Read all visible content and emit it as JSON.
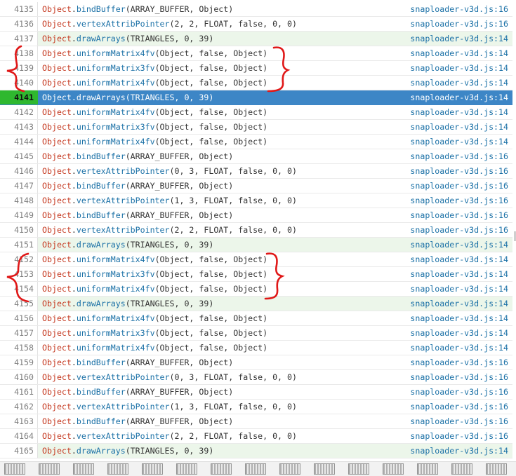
{
  "rows": [
    {
      "line": "4135",
      "obj": "Object",
      "fn": "bindBuffer",
      "args": "(ARRAY_BUFFER, Object)",
      "src": "snaploader-v3d.js:16",
      "kind": "normal"
    },
    {
      "line": "4136",
      "obj": "Object",
      "fn": "vertexAttribPointer",
      "args": "(2, 2, FLOAT, false, 0, 0)",
      "src": "snaploader-v3d.js:16",
      "kind": "normal"
    },
    {
      "line": "4137",
      "obj": "Object",
      "fn": "drawArrays",
      "args": "(TRIANGLES, 0, 39)",
      "src": "snaploader-v3d.js:14",
      "kind": "draw"
    },
    {
      "line": "4138",
      "obj": "Object",
      "fn": "uniformMatrix4fv",
      "args": "(Object, false, Object)",
      "src": "snaploader-v3d.js:14",
      "kind": "normal"
    },
    {
      "line": "4139",
      "obj": "Object",
      "fn": "uniformMatrix3fv",
      "args": "(Object, false, Object)",
      "src": "snaploader-v3d.js:14",
      "kind": "normal"
    },
    {
      "line": "4140",
      "obj": "Object",
      "fn": "uniformMatrix4fv",
      "args": "(Object, false, Object)",
      "src": "snaploader-v3d.js:14",
      "kind": "normal"
    },
    {
      "line": "4141",
      "obj": "Object",
      "fn": "drawArrays",
      "args": "(TRIANGLES, 0, 39)",
      "src": "snaploader-v3d.js:14",
      "kind": "selected"
    },
    {
      "line": "4142",
      "obj": "Object",
      "fn": "uniformMatrix4fv",
      "args": "(Object, false, Object)",
      "src": "snaploader-v3d.js:14",
      "kind": "normal"
    },
    {
      "line": "4143",
      "obj": "Object",
      "fn": "uniformMatrix3fv",
      "args": "(Object, false, Object)",
      "src": "snaploader-v3d.js:14",
      "kind": "normal"
    },
    {
      "line": "4144",
      "obj": "Object",
      "fn": "uniformMatrix4fv",
      "args": "(Object, false, Object)",
      "src": "snaploader-v3d.js:14",
      "kind": "normal"
    },
    {
      "line": "4145",
      "obj": "Object",
      "fn": "bindBuffer",
      "args": "(ARRAY_BUFFER, Object)",
      "src": "snaploader-v3d.js:16",
      "kind": "normal"
    },
    {
      "line": "4146",
      "obj": "Object",
      "fn": "vertexAttribPointer",
      "args": "(0, 3, FLOAT, false, 0, 0)",
      "src": "snaploader-v3d.js:16",
      "kind": "normal"
    },
    {
      "line": "4147",
      "obj": "Object",
      "fn": "bindBuffer",
      "args": "(ARRAY_BUFFER, Object)",
      "src": "snaploader-v3d.js:16",
      "kind": "normal"
    },
    {
      "line": "4148",
      "obj": "Object",
      "fn": "vertexAttribPointer",
      "args": "(1, 3, FLOAT, false, 0, 0)",
      "src": "snaploader-v3d.js:16",
      "kind": "normal"
    },
    {
      "line": "4149",
      "obj": "Object",
      "fn": "bindBuffer",
      "args": "(ARRAY_BUFFER, Object)",
      "src": "snaploader-v3d.js:16",
      "kind": "normal"
    },
    {
      "line": "4150",
      "obj": "Object",
      "fn": "vertexAttribPointer",
      "args": "(2, 2, FLOAT, false, 0, 0)",
      "src": "snaploader-v3d.js:16",
      "kind": "normal"
    },
    {
      "line": "4151",
      "obj": "Object",
      "fn": "drawArrays",
      "args": "(TRIANGLES, 0, 39)",
      "src": "snaploader-v3d.js:14",
      "kind": "draw"
    },
    {
      "line": "4152",
      "obj": "Object",
      "fn": "uniformMatrix4fv",
      "args": "(Object, false, Object)",
      "src": "snaploader-v3d.js:14",
      "kind": "normal"
    },
    {
      "line": "4153",
      "obj": "Object",
      "fn": "uniformMatrix3fv",
      "args": "(Object, false, Object)",
      "src": "snaploader-v3d.js:14",
      "kind": "normal"
    },
    {
      "line": "4154",
      "obj": "Object",
      "fn": "uniformMatrix4fv",
      "args": "(Object, false, Object)",
      "src": "snaploader-v3d.js:14",
      "kind": "normal"
    },
    {
      "line": "4155",
      "obj": "Object",
      "fn": "drawArrays",
      "args": "(TRIANGLES, 0, 39)",
      "src": "snaploader-v3d.js:14",
      "kind": "draw"
    },
    {
      "line": "4156",
      "obj": "Object",
      "fn": "uniformMatrix4fv",
      "args": "(Object, false, Object)",
      "src": "snaploader-v3d.js:14",
      "kind": "normal"
    },
    {
      "line": "4157",
      "obj": "Object",
      "fn": "uniformMatrix3fv",
      "args": "(Object, false, Object)",
      "src": "snaploader-v3d.js:14",
      "kind": "normal"
    },
    {
      "line": "4158",
      "obj": "Object",
      "fn": "uniformMatrix4fv",
      "args": "(Object, false, Object)",
      "src": "snaploader-v3d.js:14",
      "kind": "normal"
    },
    {
      "line": "4159",
      "obj": "Object",
      "fn": "bindBuffer",
      "args": "(ARRAY_BUFFER, Object)",
      "src": "snaploader-v3d.js:16",
      "kind": "normal"
    },
    {
      "line": "4160",
      "obj": "Object",
      "fn": "vertexAttribPointer",
      "args": "(0, 3, FLOAT, false, 0, 0)",
      "src": "snaploader-v3d.js:16",
      "kind": "normal"
    },
    {
      "line": "4161",
      "obj": "Object",
      "fn": "bindBuffer",
      "args": "(ARRAY_BUFFER, Object)",
      "src": "snaploader-v3d.js:16",
      "kind": "normal"
    },
    {
      "line": "4162",
      "obj": "Object",
      "fn": "vertexAttribPointer",
      "args": "(1, 3, FLOAT, false, 0, 0)",
      "src": "snaploader-v3d.js:16",
      "kind": "normal"
    },
    {
      "line": "4163",
      "obj": "Object",
      "fn": "bindBuffer",
      "args": "(ARRAY_BUFFER, Object)",
      "src": "snaploader-v3d.js:16",
      "kind": "normal"
    },
    {
      "line": "4164",
      "obj": "Object",
      "fn": "vertexAttribPointer",
      "args": "(2, 2, FLOAT, false, 0, 0)",
      "src": "snaploader-v3d.js:16",
      "kind": "normal"
    },
    {
      "line": "4165",
      "obj": "Object",
      "fn": "drawArrays",
      "args": "(TRIANGLES, 0, 39)",
      "src": "snaploader-v3d.js:14",
      "kind": "draw"
    }
  ],
  "colors": {
    "selected_row": "#3d86c6",
    "selected_gutter": "#2fb82f",
    "draw_row": "#ecf6ea",
    "object_token": "#c5381f",
    "function_token": "#1a70a6",
    "annotation_brace": "#e01818"
  },
  "annotations": [
    "brace-group-1",
    "brace-group-2"
  ],
  "thumbnail_strip": {
    "icon": "frame-thumbnail-icon",
    "count": 15
  }
}
